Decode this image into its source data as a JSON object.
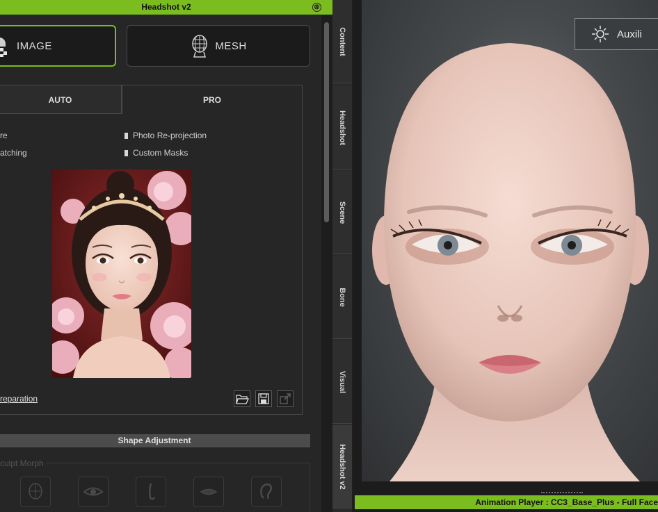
{
  "panel": {
    "title": "Headshot v2",
    "close_glyph": "⊗",
    "modes": [
      {
        "label": "IMAGE",
        "icon": "image-photo-icon",
        "selected": true
      },
      {
        "label": "MESH",
        "icon": "mesh-head-icon",
        "selected": false
      }
    ],
    "tabs": [
      {
        "label": "AUTO",
        "selected": false
      },
      {
        "label": "PRO",
        "selected": true
      }
    ],
    "options": {
      "left": [
        "re",
        "atching"
      ],
      "right": [
        "Photo Re-projection",
        "Custom Masks"
      ]
    },
    "preparation_link": "reparation",
    "file_buttons": [
      "open-folder-icon",
      "save-icon",
      "export-icon"
    ],
    "shape_adjustment_label": "Shape Adjustment",
    "sculpt_morph_label": "culpt Morph",
    "sculpt_icons": [
      "head-icon",
      "eye-icon",
      "nose-icon",
      "mouth-icon",
      "ear-icon"
    ]
  },
  "side_tabs": [
    "Content",
    "Headshot",
    "Scene",
    "Bone",
    "Visual",
    "Headshot v2"
  ],
  "active_side_tab": "Headshot v2",
  "viewport": {
    "auxiliary_label": "Auxili",
    "status_bar": "Animation Player : CC3_Base_Plus - Full Face"
  },
  "colors": {
    "accent": "#7bbd1e",
    "panel_bg": "#262626"
  }
}
